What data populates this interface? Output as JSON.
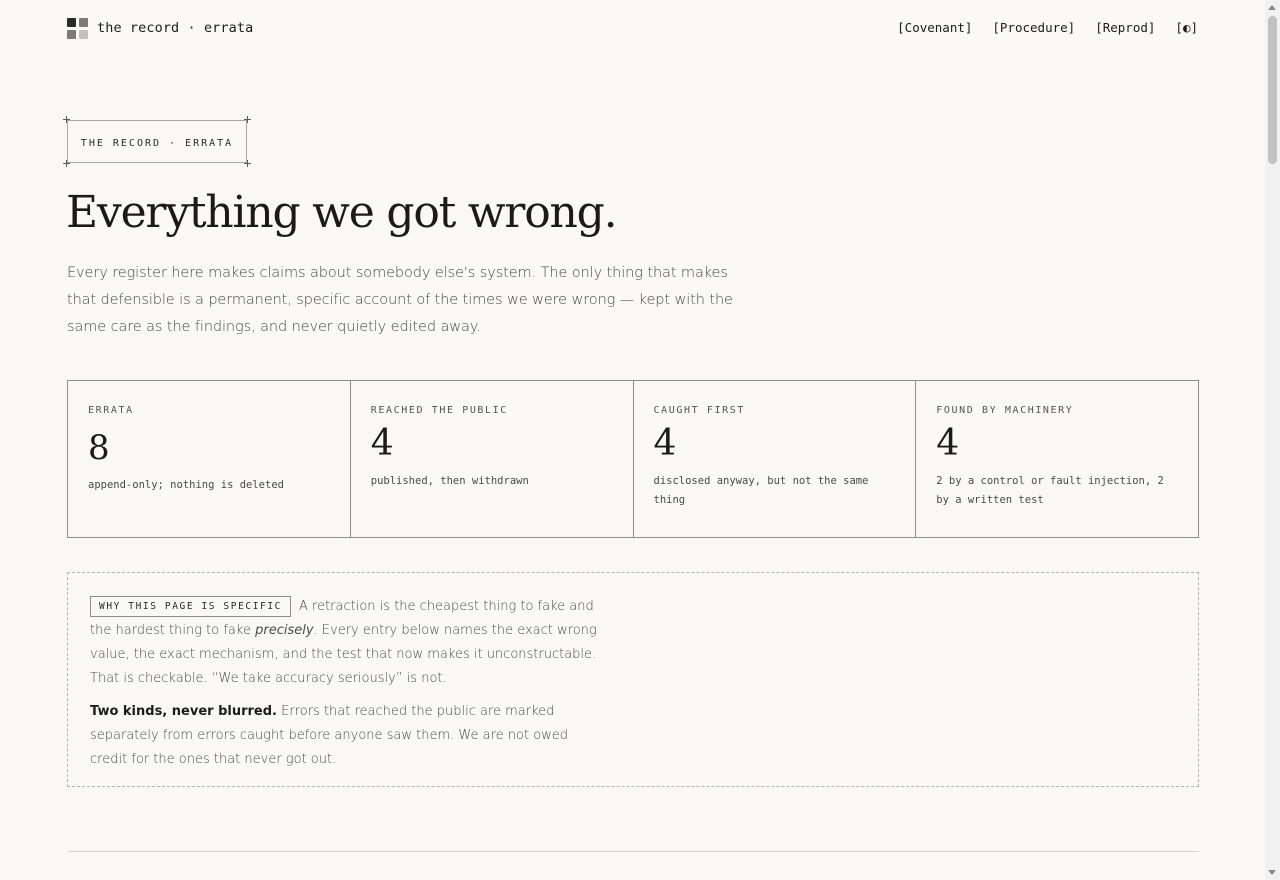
{
  "header": {
    "brand": "the record · errata",
    "nav": [
      "[Covenant]",
      "[Procedure]",
      "[Reprod]",
      "[◐]"
    ]
  },
  "stamp": "THE RECORD · ERRATA",
  "title": "Everything we got wrong.",
  "lede": "Every register here makes claims about somebody else's system. The only thing that makes that defensible is a permanent, specific account of the times we were wrong — kept with the same care as the findings, and never quietly edited away.",
  "stats": [
    {
      "label": "ERRATA",
      "value": "8",
      "note": "append-only; nothing is deleted"
    },
    {
      "label": "REACHED THE PUBLIC",
      "value": "4",
      "note": "published, then withdrawn"
    },
    {
      "label": "CAUGHT FIRST",
      "value": "4",
      "note": "disclosed anyway, but not the same thing"
    },
    {
      "label": "FOUND BY MACHINERY",
      "value": "4",
      "note": "2 by a control or fault injection, 2 by a written test"
    }
  ],
  "why": {
    "tag": "WHY THIS PAGE IS SPECIFIC",
    "p1_a": "A retraction is the cheapest thing to fake and the hardest thing to fake ",
    "p1_em": "precisely",
    "p1_b": ". Every entry below names the exact wrong value, the exact mechanism, and the test that now makes it unconstructable. That is checkable. “We take accuracy seriously” is not.",
    "p2_strong": "Two kinds, never blurred.",
    "p2_rest": " Errors that reached the public are marked separately from errors caught before anyone saw them. We are not owed credit for the ones that never got out."
  },
  "colors": {
    "background": "#f9f8f4",
    "ink": "#1c1c1a",
    "muted": "#4a4a46",
    "rule": "#8d8c87"
  }
}
